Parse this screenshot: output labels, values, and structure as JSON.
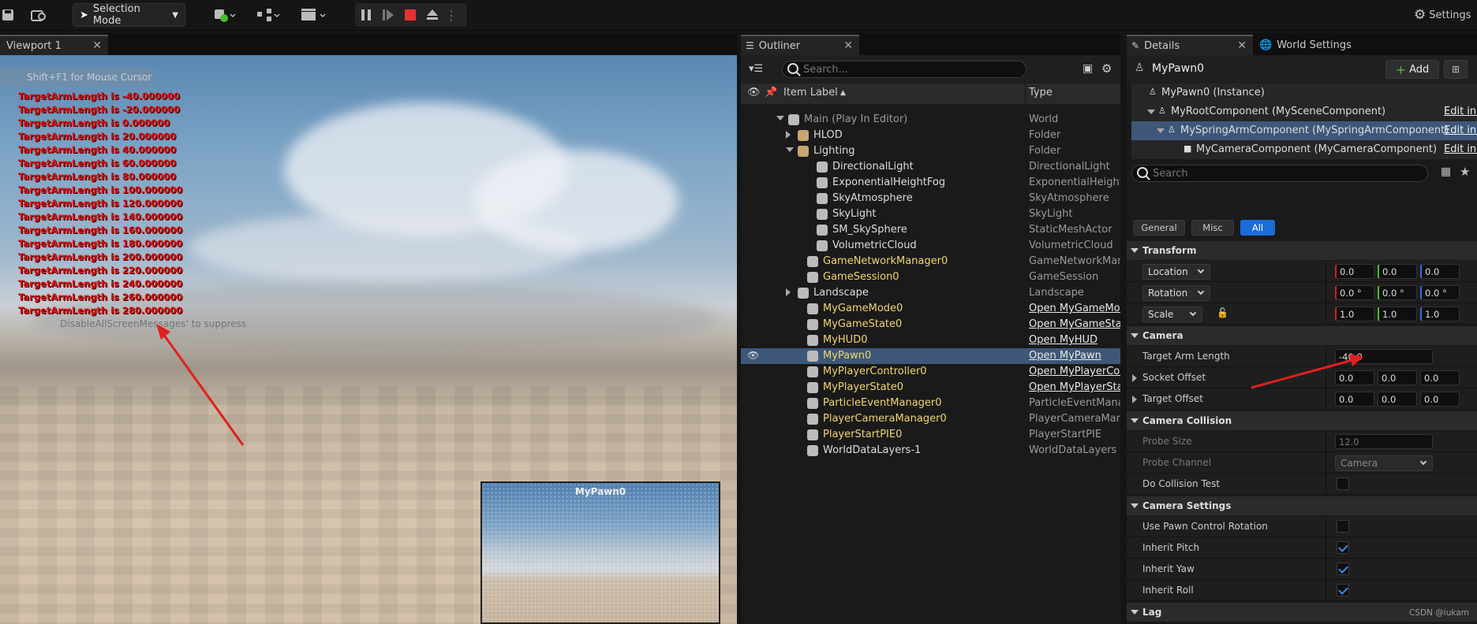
{
  "toolbar": {
    "selection_mode": "Selection Mode",
    "settings": "Settings"
  },
  "viewport": {
    "tab": "Viewport 1",
    "mouse_hint": "Shift+F1 for Mouse Cursor",
    "debug_lines": [
      "TargetArmLength is -40.000000",
      "TargetArmLength is -20.000000",
      "TargetArmLength is 0.000000",
      "TargetArmLength is 20.000000",
      "TargetArmLength is 40.000000",
      "TargetArmLength is 60.000000",
      "TargetArmLength is 80.000000",
      "TargetArmLength is 100.000000",
      "TargetArmLength is 120.000000",
      "TargetArmLength is 140.000000",
      "TargetArmLength is 160.000000",
      "TargetArmLength is 180.000000",
      "TargetArmLength is 200.000000",
      "TargetArmLength is 220.000000",
      "TargetArmLength is 240.000000",
      "TargetArmLength is 260.000000",
      "TargetArmLength is 280.000000"
    ],
    "suppress": "DisableAllScreenMessages' to suppress",
    "pip_title": "MyPawn0"
  },
  "outliner": {
    "tab": "Outliner",
    "search_placeholder": "Search...",
    "col_label": "Item Label",
    "col_type": "Type",
    "rows": [
      {
        "label": "Main (Play In Editor)",
        "type": "World"
      },
      {
        "label": "HLOD",
        "type": "Folder"
      },
      {
        "label": "Lighting",
        "type": "Folder"
      },
      {
        "label": "DirectionalLight",
        "type": "DirectionalLight"
      },
      {
        "label": "ExponentialHeightFog",
        "type": "ExponentialHeightFog"
      },
      {
        "label": "SkyAtmosphere",
        "type": "SkyAtmosphere"
      },
      {
        "label": "SkyLight",
        "type": "SkyLight"
      },
      {
        "label": "SM_SkySphere",
        "type": "StaticMeshActor"
      },
      {
        "label": "VolumetricCloud",
        "type": "VolumetricCloud"
      },
      {
        "label": "GameNetworkManager0",
        "type": "GameNetworkManager"
      },
      {
        "label": "GameSession0",
        "type": "GameSession"
      },
      {
        "label": "Landscape",
        "type": "Landscape"
      },
      {
        "label": "MyGameMode0",
        "type": "Open MyGameMode"
      },
      {
        "label": "MyGameState0",
        "type": "Open MyGameState"
      },
      {
        "label": "MyHUD0",
        "type": "Open MyHUD"
      },
      {
        "label": "MyPawn0",
        "type": "Open MyPawn"
      },
      {
        "label": "MyPlayerController0",
        "type": "Open MyPlayerController"
      },
      {
        "label": "MyPlayerState0",
        "type": "Open MyPlayerState"
      },
      {
        "label": "ParticleEventManager0",
        "type": "ParticleEventManager"
      },
      {
        "label": "PlayerCameraManager0",
        "type": "PlayerCameraManager"
      },
      {
        "label": "PlayerStartPIE0",
        "type": "PlayerStartPIE"
      },
      {
        "label": "WorldDataLayers-1",
        "type": "WorldDataLayers"
      }
    ]
  },
  "details": {
    "tab": "Details",
    "world_tab": "World Settings",
    "actor": "MyPawn0",
    "add": "Add",
    "components": [
      "MyPawn0 (Instance)",
      "MyRootComponent (MySceneComponent)",
      "MySpringArmComponent (MySpringArmComponent)",
      "MyCameraComponent (MyCameraComponent)"
    ],
    "edit_link": "Edit in C++",
    "search_placeholder": "Search",
    "filters": [
      "General",
      "Misc",
      "All"
    ],
    "transform": {
      "title": "Transform",
      "location": "Location",
      "rotation": "Rotation",
      "scale": "Scale",
      "loc": [
        "0.0",
        "0.0",
        "0.0"
      ],
      "rot": [
        "0.0 °",
        "0.0 °",
        "0.0 °"
      ],
      "scl": [
        "1.0",
        "1.0",
        "1.0"
      ]
    },
    "camera": {
      "title": "Camera",
      "target_arm_length": "Target Arm Length",
      "tal_value": "-40.0",
      "socket_offset": "Socket Offset",
      "target_offset": "Target Offset",
      "so": [
        "0.0",
        "0.0",
        "0.0"
      ],
      "to": [
        "0.0",
        "0.0",
        "0.0"
      ]
    },
    "collision": {
      "title": "Camera Collision",
      "probe_size": "Probe Size",
      "probe_size_value": "12.0",
      "probe_channel": "Probe Channel",
      "probe_channel_value": "Camera",
      "do_test": "Do Collision Test"
    },
    "settings": {
      "title": "Camera Settings",
      "use_pawn": "Use Pawn Control Rotation",
      "pitch": "Inherit Pitch",
      "yaw": "Inherit Yaw",
      "roll": "Inherit Roll"
    },
    "lag": {
      "title": "Lag"
    }
  },
  "watermark": "CSDN @iukam",
  "colors": {
    "accent": "#1a6cd7",
    "selection": "#3e5778",
    "debug_text": "#e0120f",
    "arrow": "#e02020",
    "actor_yellow": "#f2d56b"
  }
}
